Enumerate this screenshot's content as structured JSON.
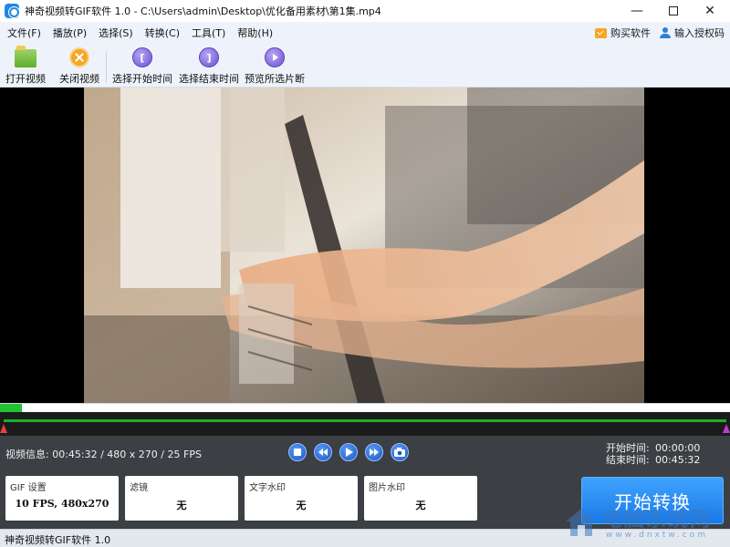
{
  "window": {
    "title": "神奇视频转GIF软件 1.0 - C:\\Users\\admin\\Desktop\\优化备用素材\\第1集.mp4",
    "minimize": "—",
    "close": "✕"
  },
  "menu": {
    "items": [
      "文件(F)",
      "播放(P)",
      "选择(S)",
      "转换(C)",
      "工具(T)",
      "帮助(H)"
    ],
    "buy": "购买软件",
    "register": "输入授权码"
  },
  "toolbar": {
    "open": "打开视频",
    "close": "关闭视频",
    "select_start": "选择开始时间",
    "select_end": "选择结束时间",
    "preview": "预览所选片断",
    "select_start_glyph": "[",
    "select_end_glyph": "]"
  },
  "progress": {
    "played_fraction": 0.03
  },
  "video_info": "视频信息: 00:45:32 / 480 x 270 / 25 FPS",
  "time": {
    "start_label": "开始时间:",
    "start_value": "00:00:00",
    "end_label": "结束时间:",
    "end_value": "00:45:32"
  },
  "cards": {
    "gif": {
      "title": "GIF 设置",
      "value": "10 FPS, 480x270"
    },
    "filter": {
      "title": "滤镜",
      "value": "无"
    },
    "text_watermark": {
      "title": "文字水印",
      "value": "无"
    },
    "image_watermark": {
      "title": "图片水印",
      "value": "无"
    }
  },
  "start_button": "开始转换",
  "status": "神奇视频转GIF软件 1.0",
  "watermark": {
    "name": "电脑系统网",
    "url": "www.dnxtw.com"
  },
  "colors": {
    "accent": "#1a79e6",
    "progress": "#22c233",
    "start_marker": "#e83f3f",
    "end_marker": "#b73fd0",
    "panel": "#3c3f44"
  }
}
